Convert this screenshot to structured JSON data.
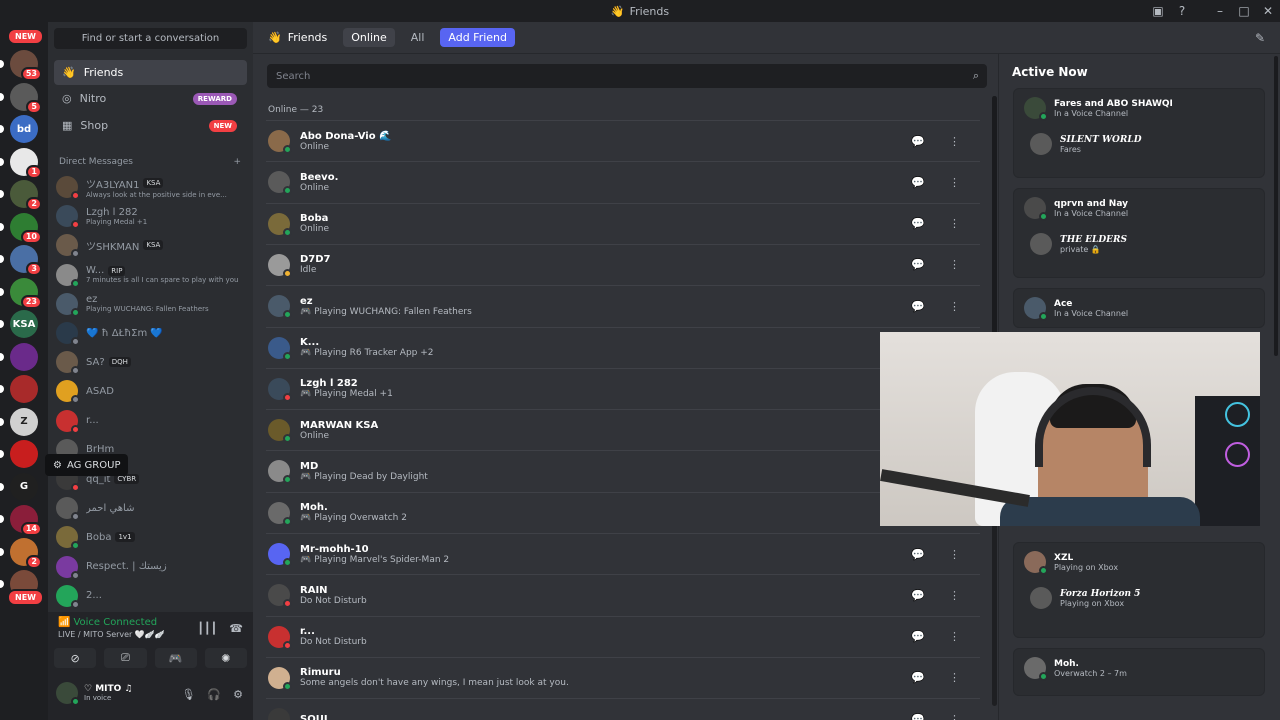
{
  "window": {
    "title": "Friends"
  },
  "guilds": [
    {
      "badge": "53",
      "color": "#6b4b3e"
    },
    {
      "badge": "5",
      "color": "#5a5a5a"
    },
    {
      "badge": "",
      "color": "#3b6cc4",
      "text": "bd"
    },
    {
      "badge": "1",
      "color": "#e8e8e8"
    },
    {
      "badge": "2",
      "color": "#4a5a3a"
    },
    {
      "badge": "10",
      "color": "#2e7d32"
    },
    {
      "badge": "3",
      "color": "#4a6fa5"
    },
    {
      "badge": "23",
      "color": "#3a8a3a"
    },
    {
      "badge": "",
      "color": "#2a6a4a",
      "text": "KSA"
    },
    {
      "badge": "",
      "color": "#6a2a8a"
    },
    {
      "badge": "",
      "color": "#a82a2a"
    },
    {
      "badge": "",
      "color": "#d0d0d0",
      "text": "Z"
    },
    {
      "badge": "",
      "color": "#c81e1e"
    },
    {
      "badge": "",
      "color": "#202020",
      "text": "G"
    },
    {
      "badge": "14",
      "color": "#8a1e3a"
    },
    {
      "badge": "2",
      "color": "#c07030"
    },
    {
      "badge": "",
      "color": "#7a4a3a"
    }
  ],
  "guild_new_top": "NEW",
  "guild_new_bottom": "NEW",
  "tooltip": "AG GROUP",
  "sidebar": {
    "find": "Find or start a conversation",
    "nav": [
      {
        "label": "Friends"
      },
      {
        "label": "Nitro",
        "tag": "REWARD",
        "tag_color": "#9b59b6"
      },
      {
        "label": "Shop",
        "tag": "NEW",
        "tag_color": "#f23f43"
      }
    ],
    "dm_header": "Direct Messages",
    "dm_add": "+",
    "dms": [
      {
        "name": "ツA3LYAN1",
        "tag": "KSA",
        "sub": "Always look at the positive side in eve...",
        "color": "#5a4a3a",
        "status": "#f23f43"
      },
      {
        "name": "Lzgh l 282",
        "tag": "",
        "sub": "Playing Medal +1",
        "color": "#3a4a5a",
        "status": "#f23f43"
      },
      {
        "name": "ツSHKMAN",
        "tag": "KSA",
        "sub": "",
        "color": "#6a5a4a",
        "status": "#80848e"
      },
      {
        "name": "W...",
        "tag": "RIP",
        "sub": "7 minutes is all I can spare to play with you",
        "color": "#8a8a8a",
        "status": "#23a55a"
      },
      {
        "name": "ez",
        "tag": "",
        "sub": "Playing WUCHANG: Fallen Feathers",
        "color": "#4a5a6a",
        "status": "#23a55a"
      },
      {
        "name": "💙 ħ ΔŁħΣm 💙",
        "tag": "",
        "sub": "",
        "color": "#2a3a4a",
        "status": "#80848e"
      },
      {
        "name": "SA?",
        "tag": "DQH",
        "sub": "",
        "color": "#6a5a4a",
        "status": "#80848e"
      },
      {
        "name": "ASAD",
        "tag": "",
        "sub": "",
        "color": "#e0a020",
        "status": "#80848e"
      },
      {
        "name": "r...",
        "tag": "",
        "sub": "",
        "color": "#c83030",
        "status": "#f23f43"
      },
      {
        "name": "BrHm",
        "tag": "",
        "sub": "",
        "color": "#5a5a5a",
        "status": "#80848e"
      },
      {
        "name": "qq_it",
        "tag": "CYBR",
        "sub": "",
        "color": "#3a3a3a",
        "status": "#f23f43"
      },
      {
        "name": "شاهي احمر",
        "tag": "",
        "sub": "",
        "color": "#5a5a5a",
        "status": "#80848e"
      },
      {
        "name": "Boba",
        "tag": "1v1",
        "sub": "",
        "color": "#7a6a3a",
        "status": "#23a55a"
      },
      {
        "name": "Respect. | زيستك",
        "tag": "",
        "sub": "",
        "color": "#7a3aa0",
        "status": "#80848e"
      },
      {
        "name": "2...",
        "tag": "",
        "sub": "",
        "color": "#23a55a",
        "status": "#80848e"
      }
    ]
  },
  "voice": {
    "status": "Voice Connected",
    "channel": "LIVE / MITO Server 🤍🪽🪽",
    "buttons": [
      "⊘",
      "⎚",
      "🎮",
      "✺"
    ]
  },
  "user": {
    "name": "♡ MITO ♫",
    "sub": "In voice"
  },
  "header": {
    "title": "Friends",
    "tabs": [
      "Online",
      "All"
    ],
    "add": "Add Friend"
  },
  "search": {
    "placeholder": "Search"
  },
  "online_count": "Online — 23",
  "friends": [
    {
      "name": "Abo Dona-Vio 🌊",
      "sub": "Online",
      "color": "#8a6a4a",
      "status": "#23a55a",
      "game": false
    },
    {
      "name": "Beevo.",
      "sub": "Online",
      "color": "#5a5a5a",
      "status": "#23a55a",
      "game": false
    },
    {
      "name": "Boba",
      "sub": "Online",
      "color": "#7a6a3a",
      "status": "#23a55a",
      "game": false
    },
    {
      "name": "D7D7",
      "sub": "Idle",
      "color": "#9a9a9a",
      "status": "#f0b232",
      "game": false
    },
    {
      "name": "ez",
      "sub": "Playing WUCHANG: Fallen Feathers",
      "color": "#4a5a6a",
      "status": "#23a55a",
      "game": true
    },
    {
      "name": "K...",
      "sub": "Playing R6 Tracker App +2",
      "color": "#3a5a8a",
      "status": "#23a55a",
      "game": true
    },
    {
      "name": "Lzgh l 282",
      "sub": "Playing Medal +1",
      "color": "#3a4a5a",
      "status": "#f23f43",
      "game": true
    },
    {
      "name": "MARWAN KSA",
      "sub": "Online",
      "color": "#6a5a2a",
      "status": "#23a55a",
      "game": false
    },
    {
      "name": "MD",
      "sub": "Playing Dead by Daylight",
      "color": "#8a8a8a",
      "status": "#23a55a",
      "game": true
    },
    {
      "name": "Moh.",
      "sub": "Playing Overwatch 2",
      "color": "#6a6a6a",
      "status": "#23a55a",
      "game": true
    },
    {
      "name": "Mr-mohh-10",
      "sub": "Playing Marvel's Spider-Man 2",
      "color": "#5865f2",
      "status": "#23a55a",
      "game": true
    },
    {
      "name": "RAIN",
      "sub": "Do Not Disturb",
      "color": "#4a4a4a",
      "status": "#f23f43",
      "game": false
    },
    {
      "name": "r...",
      "sub": "Do Not Disturb",
      "color": "#c83030",
      "status": "#f23f43",
      "game": false
    },
    {
      "name": "Rimuru",
      "sub": "Some angels don't have any wings, I mean just look at you.",
      "color": "#d0b090",
      "status": "#23a55a",
      "game": false
    },
    {
      "name": "SOUL",
      "sub": "",
      "color": "#3a3a3a",
      "status": "#23a55a",
      "game": false
    }
  ],
  "active_now": {
    "title": "Active Now",
    "cards": [
      {
        "title": "Fares and ABO SHAWQI",
        "sub": "In a Voice Channel",
        "inner_title": "SILENT WORLD",
        "inner_sub": "Fares",
        "color": "#3a4a3a"
      },
      {
        "title": "qprvn and Nay",
        "sub": "In a Voice Channel",
        "inner_title": "THE ELDERS",
        "inner_sub": "private 🔒",
        "color": "#4a4a4a"
      },
      {
        "title": "Ace",
        "sub": "In a Voice Channel",
        "inner_title": "",
        "inner_sub": "",
        "color": "#4a5a6a"
      },
      {
        "title": "XZL",
        "sub": "Playing on Xbox",
        "inner_title": "Forza Horizon 5",
        "inner_sub": "Playing on Xbox",
        "color": "#8a6a5a"
      },
      {
        "title": "Moh.",
        "sub": "Overwatch 2 – 7m",
        "inner_title": "",
        "inner_sub": "",
        "color": "#6a6a6a"
      }
    ]
  }
}
